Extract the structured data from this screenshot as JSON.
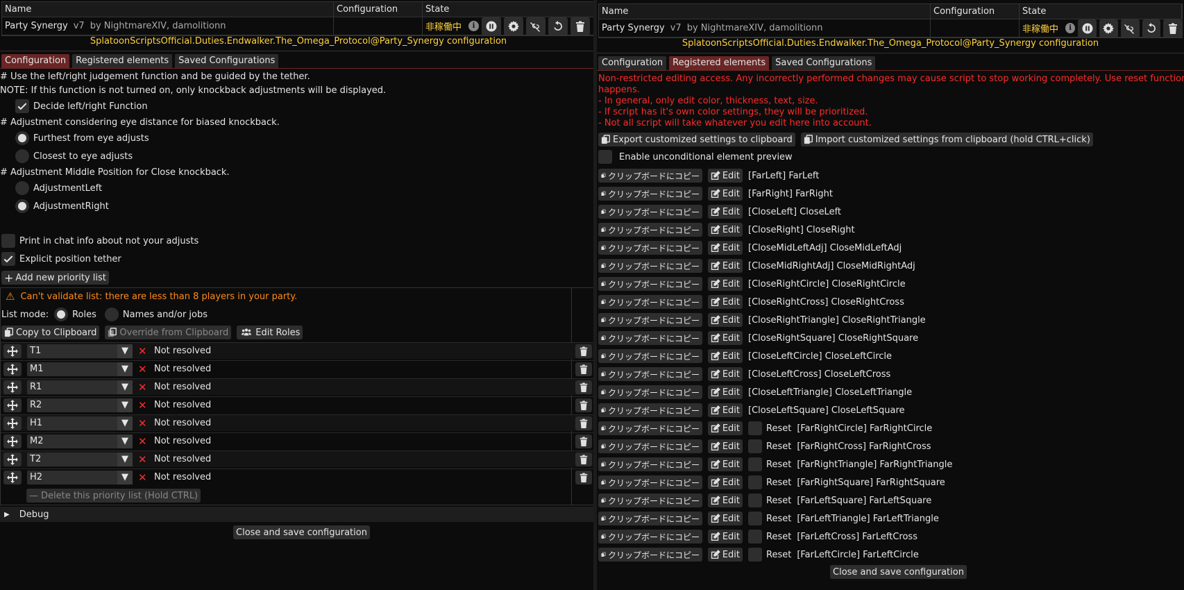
{
  "colors": {
    "accent_tab": "#6a2525",
    "state_yellow": "#ffd23c",
    "warning_orange": "#ff8a1a",
    "error_red": "#ff2a2a"
  },
  "header": {
    "col_name": "Name",
    "col_config": "Configuration",
    "col_state": "State",
    "plugin_name": "Party Synergy",
    "version": "v7",
    "author": "by NightmareXIV, damolitionn",
    "state": "非稼働中"
  },
  "config_title": "SplatoonScriptsOfficial.Duties.Endwalker.The_Omega_Protocol@Party_Synergy configuration",
  "tabs": [
    "Configuration",
    "Registered elements",
    "Saved Configurations"
  ],
  "left": {
    "line1": "# Use the left/right judgement function and be guided by the tether.",
    "line2": "NOTE: If this function is not turned on, only knockback adjustments will be displayed.",
    "decide_lr": "Decide left/right Function",
    "line3": "# Adjustment considering eye distance for biased knockback.",
    "furthest": "Furthest from eye adjusts",
    "closest": "Closest to eye adjusts",
    "line4": "# Adjustment Middle Position for Close knockback.",
    "adj_left": "AdjustmentLeft",
    "adj_right": "AdjustmentRight",
    "print_chat": "Print in chat info about not your adjusts",
    "explicit_tether": "Explicit position tether",
    "add_priority": "Add new priority list",
    "warning": "Can't validate list: there are less than 8 players in your party.",
    "list_mode": "List mode:",
    "mode_roles": "Roles",
    "mode_names": "Names and/or jobs",
    "copy_clip": "Copy to Clipboard",
    "override_clip": "Override from Clipboard",
    "edit_roles": "Edit Roles",
    "roles": [
      {
        "role": "T1",
        "status": "Not resolved"
      },
      {
        "role": "M1",
        "status": "Not resolved"
      },
      {
        "role": "R1",
        "status": "Not resolved"
      },
      {
        "role": "R2",
        "status": "Not resolved"
      },
      {
        "role": "H1",
        "status": "Not resolved"
      },
      {
        "role": "M2",
        "status": "Not resolved"
      },
      {
        "role": "T2",
        "status": "Not resolved"
      },
      {
        "role": "H2",
        "status": "Not resolved"
      }
    ],
    "delete_list": "Delete this priority list (Hold CTRL)",
    "debug": "Debug",
    "close_save": "Close and save configuration"
  },
  "right": {
    "notice": [
      "Non-restricted editing access. Any incorrectly performed changes may cause script to stop working completely. Use reset function if it",
      "happens.",
      "- In general, only edit color, thickness, text, size.",
      "- If script has it's own color settings, they will be prioritized.",
      "- Not all script will take whatever you edit here into account."
    ],
    "export_btn": "Export customized settings to clipboard",
    "import_btn": "Import customized settings from clipboard (hold CTRL+click)",
    "enable_preview": "Enable unconditional element preview",
    "copy_label": "クリップボードにコピー",
    "edit_label": "Edit",
    "reset_label": "Reset",
    "elements": [
      "[FarLeft] FarLeft",
      "[FarRight] FarRight",
      "[CloseLeft] CloseLeft",
      "[CloseRight] CloseRight",
      "[CloseMidLeftAdj] CloseMidLeftAdj",
      "[CloseMidRightAdj] CloseMidRightAdj",
      "[CloseRightCircle] CloseRightCircle",
      "[CloseRightCross] CloseRightCross",
      "[CloseRightTriangle] CloseRightTriangle",
      "[CloseRightSquare] CloseRightSquare",
      "[CloseLeftCircle] CloseLeftCircle",
      "[CloseLeftCross] CloseLeftCross",
      "[CloseLeftTriangle] CloseLeftTriangle",
      "[CloseLeftSquare] CloseLeftSquare"
    ],
    "reset_elements": [
      "[FarRightCircle] FarRightCircle",
      "[FarRightCross] FarRightCross",
      "[FarRightTriangle] FarRightTriangle",
      "[FarRightSquare] FarRightSquare",
      "[FarLeftSquare] FarLeftSquare",
      "[FarLeftTriangle] FarLeftTriangle",
      "[FarLeftCross] FarLeftCross",
      "[FarLeftCircle] FarLeftCircle"
    ],
    "close_save": "Close and save configuration"
  }
}
